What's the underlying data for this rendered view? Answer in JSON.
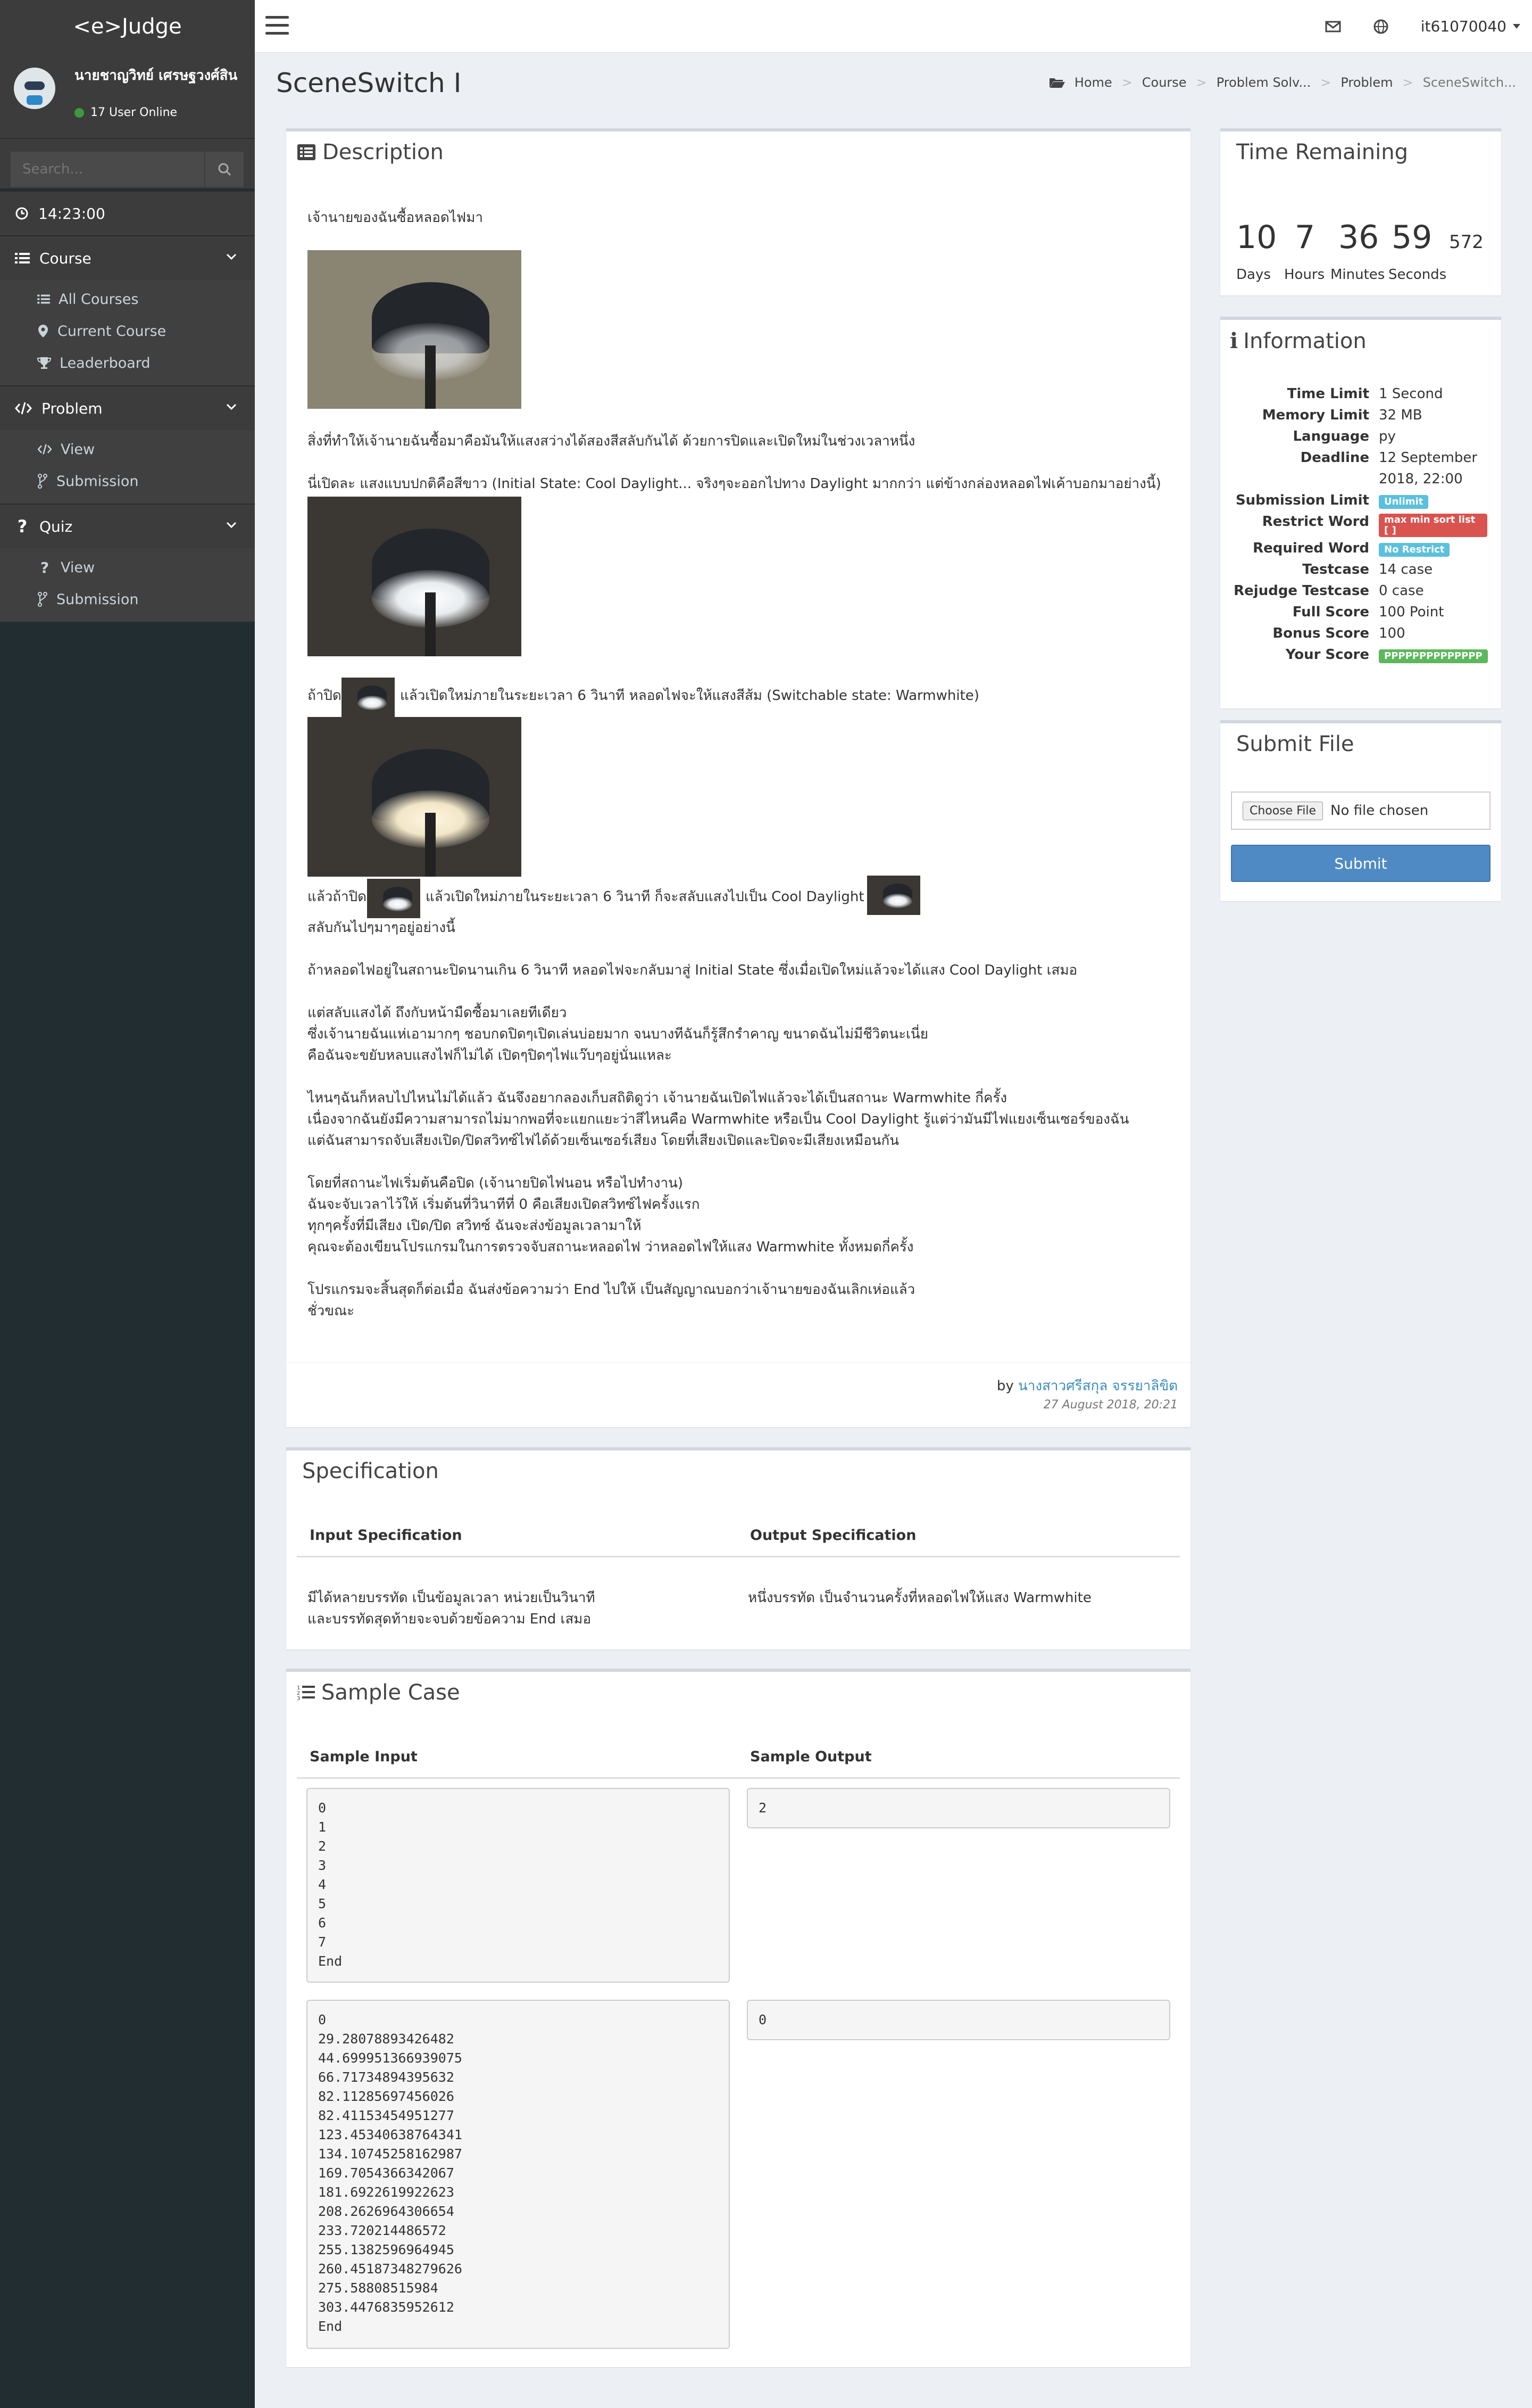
{
  "app": {
    "logo": "<e>Judge"
  },
  "user": {
    "name": "นายชาญวิทย์ เศรษฐวงศ์สิน",
    "online": "17 User Online",
    "account": "it61070040"
  },
  "sidebar": {
    "search_placeholder": "Search...",
    "time": "14:23:00",
    "course": {
      "label": "Course",
      "items": [
        "All Courses",
        "Current Course",
        "Leaderboard"
      ]
    },
    "problem": {
      "label": "Problem",
      "items": [
        "View",
        "Submission"
      ]
    },
    "quiz": {
      "label": "Quiz",
      "items": [
        "View",
        "Submission"
      ]
    }
  },
  "page": {
    "title": "SceneSwitch I"
  },
  "breadcrumb": [
    "Home",
    "Course",
    "Problem Solv...",
    "Problem",
    "SceneSwitch..."
  ],
  "description": {
    "title": "Description",
    "lines": [
      "เจ้านายของฉันซื้อหลอดไฟมา",
      "สิ่งที่ทำให้เจ้านายฉันซื้อมาคือมันให้แสงสว่างได้สองสีสลับกันได้ ด้วยการปิดและเปิดใหม่ในช่วงเวลาหนึ่ง",
      "นี่เปิดละ แสงแบบปกติคือสีขาว (Initial State: Cool Daylight... จริงๆจะออกไปทาง Daylight มากกว่า แต่ข้างกล่องหลอดไฟเค้าบอกมาอย่างนี้)",
      "ถ้าปิด",
      "แล้วเปิดใหม่ภายในระยะเวลา 6 วินาที หลอดไฟจะให้แสงสีส้ม (Switchable state: Warmwhite)",
      "แล้วถ้าปิด",
      "แล้วเปิดใหม่ภายในระยะเวลา 6 วินาที ก็จะสลับแสงไปเป็น Cool Daylight",
      "สลับกันไปๆมาๆอยู่อย่างนี้",
      "ถ้าหลอดไฟอยู่ในสถานะปิดนานเกิน 6 วินาที หลอดไฟจะกลับมาสู่ Initial State ซึ่งเมื่อเปิดใหม่แล้วจะได้แสง Cool Daylight เสมอ",
      "แต่สลับแสงได้ ถึงกับหน้ามืดซื้อมาเลยทีเดียว",
      "ซึ่งเจ้านายฉันแห่เอามากๆ ชอบกดปิดๆเปิดเล่นบ่อยมาก จนบางทีฉันก็รู้สึกรำคาญ ขนาดฉันไม่มีชีวิตนะเนี่ย",
      "คือฉันจะขยับหลบแสงไฟก็ไม่ได้ เปิดๆปิดๆไฟแว๊บๆอยู่นั่นแหละ",
      "ไหนๆฉันก็หลบไปไหนไม่ได้แล้ว ฉันจึงอยากลองเก็บสถิติดูว่า เจ้านายฉันเปิดไฟแล้วจะได้เป็นสถานะ Warmwhite กี่ครั้ง",
      "เนื่องจากฉันยังมีความสามารถไม่มากพอที่จะแยกแยะว่าสีไหนคือ Warmwhite หรือเป็น Cool Daylight รู้แต่ว่ามันมีไฟแยงเซ็นเซอร์ของฉัน",
      "แต่ฉันสามารถจับเสียงเปิด/ปิดสวิทซ์ไฟได้ด้วยเซ็นเซอร์เสียง โดยที่เสียงเปิดและปิดจะมีเสียงเหมือนกัน",
      "โดยที่สถานะไฟเริ่มต้นคือปิด (เจ้านายปิดไฟนอน หรือไปทำงาน)",
      "ฉันจะจับเวลาไว้ให้ เริ่มต้นที่วินาทีที่ 0 คือเสียงเปิดสวิทซ์ไฟครั้งแรก",
      "ทุกๆครั้งที่มีเสียง เปิด/ปิด สวิทซ์ ฉันจะส่งข้อมูลเวลามาให้",
      "คุณจะต้องเขียนโปรแกรมในการตรวจจับสถานะหลอดไฟ ว่าหลอดไฟให้แสง Warmwhite ทั้งหมดกี่ครั้ง",
      "โปรแกรมจะสิ้นสุดก็ต่อเมื่อ ฉันส่งข้อความว่า End ไปให้ เป็นสัญญาณบอกว่าเจ้านายของฉันเลิกเห่อแล้ว",
      "ชั่วขณะ"
    ],
    "by_label": "by",
    "author": "นางสาวศรีสกุล จรรยาลิขิต",
    "date": "27 August 2018, 20:21"
  },
  "time_remaining": {
    "title": "Time Remaining",
    "days": "10",
    "hours": "7",
    "minutes": "36",
    "seconds": "59",
    "ms": "572",
    "labels": [
      "Days",
      "Hours",
      "Minutes",
      "Seconds"
    ]
  },
  "information": {
    "title": "Information",
    "time_limit": {
      "k": "Time Limit",
      "v": "1 Second"
    },
    "memory_limit": {
      "k": "Memory Limit",
      "v": "32 MB"
    },
    "language": {
      "k": "Language",
      "v": "py"
    },
    "deadline": {
      "k": "Deadline",
      "v1": "12 September",
      "v2": "2018, 22:00"
    },
    "submission_limit": {
      "k": "Submission Limit",
      "v": "Unlimit"
    },
    "restrict_word": {
      "k": "Restrict Word",
      "v": "max min sort list [ ]"
    },
    "required_word": {
      "k": "Required Word",
      "v": "No Restrict"
    },
    "testcase": {
      "k": "Testcase",
      "v": "14 case"
    },
    "rejudge": {
      "k": "Rejudge Testcase",
      "v": "0 case"
    },
    "full_score": {
      "k": "Full Score",
      "v": "100 Point"
    },
    "bonus_score": {
      "k": "Bonus Score",
      "v": "100"
    },
    "your_score": {
      "k": "Your Score",
      "v": "PPPPPPPPPPPPPP"
    },
    "colors": {
      "info": "#5bc0de",
      "danger": "#d9534f",
      "success": "#5cb85c"
    }
  },
  "submit": {
    "title": "Submit File",
    "choose": "Choose File",
    "no_file": "No file chosen",
    "button": "Submit"
  },
  "specification": {
    "title": "Specification",
    "input_header": "Input Specification",
    "output_header": "Output Specification",
    "input_lines": [
      "มีได้หลายบรรทัด เป็นข้อมูลเวลา หน่วยเป็นวินาที",
      "และบรรทัดสุดท้ายจะจบด้วยข้อความ End เสมอ"
    ],
    "output_text": "หนึ่งบรรทัด เป็นจำนวนครั้งที่หลอดไฟให้แสง Warmwhite"
  },
  "sample": {
    "title": "Sample Case",
    "input_header": "Sample Input",
    "output_header": "Sample Output",
    "case1_input": "0\n1\n2\n3\n4\n5\n6\n7\nEnd",
    "case1_output": "2",
    "case2_input": "0\n29.28078893426482\n44.699951366939075\n66.71734894395632\n82.11285697456026\n82.41153454951277\n123.45340638764341\n134.10745258162987\n169.7054366342067\n181.6922619922623\n208.2626964306654\n233.720214486572\n255.1382596964945\n260.45187348279626\n275.58808515984\n303.4476835952612\nEnd",
    "case2_output": "0"
  }
}
